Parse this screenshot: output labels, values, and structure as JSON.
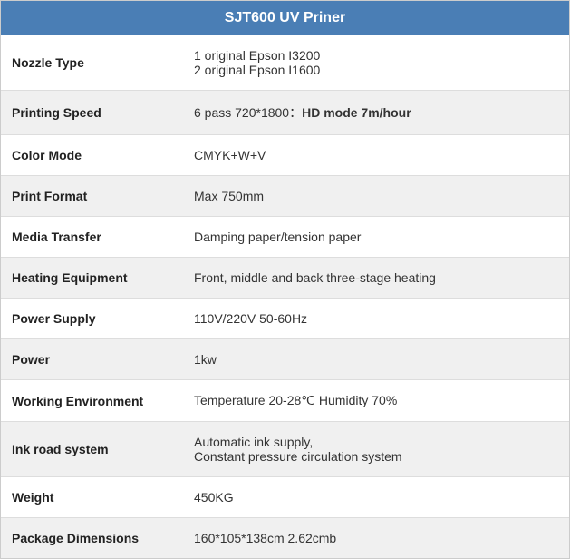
{
  "header": {
    "title": "SJT600 UV Priner"
  },
  "rows": [
    {
      "id": "nozzle-type",
      "label": "Nozzle Type",
      "value": "1 original Epson I3200\n2 original Epson I1600",
      "shaded": false,
      "multiline": true
    },
    {
      "id": "printing-speed",
      "label": "Printing Speed",
      "value_prefix": "6 pass 720*1800：",
      "value_bold": "HD mode 7m/hour",
      "shaded": true,
      "mixed": true
    },
    {
      "id": "color-mode",
      "label": "Color Mode",
      "value": "CMYK+W+V",
      "shaded": false
    },
    {
      "id": "print-format",
      "label": "Print Format",
      "value": "Max 750mm",
      "shaded": true
    },
    {
      "id": "media-transfer",
      "label": "Media Transfer",
      "value": "Damping paper/tension paper",
      "shaded": false
    },
    {
      "id": "heating-equipment",
      "label": "Heating Equipment",
      "value": "Front, middle and back three-stage heating",
      "shaded": true
    },
    {
      "id": "power-supply",
      "label": "Power Supply",
      "value": "110V/220V 50-60Hz",
      "shaded": false
    },
    {
      "id": "power",
      "label": "Power",
      "value": "1kw",
      "shaded": true
    },
    {
      "id": "working-environment",
      "label": "Working Environment",
      "value": "Temperature 20-28℃ Humidity 70%",
      "shaded": false
    },
    {
      "id": "ink-road-system",
      "label": "Ink road system",
      "value": "Automatic ink supply,\nConstant pressure circulation system",
      "shaded": true,
      "multiline": true
    },
    {
      "id": "weight",
      "label": "Weight",
      "value": "450KG",
      "shaded": false
    },
    {
      "id": "package-dimensions",
      "label": "Package Dimensions",
      "value": "160*105*138cm 2.62cmb",
      "shaded": true
    }
  ]
}
